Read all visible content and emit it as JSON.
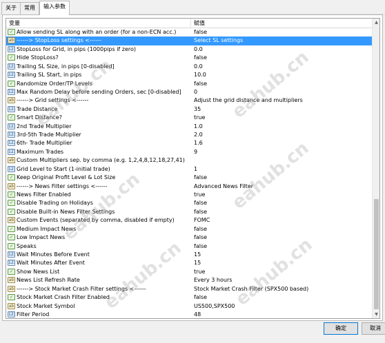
{
  "tabs": [
    "关于",
    "常用",
    "输入参数"
  ],
  "grid": {
    "header": {
      "name": "变量",
      "value": "赋值"
    },
    "rows": [
      {
        "name": "Allow sending SL along with an order (for a non-ECN acc.)",
        "value": "false",
        "icon": "bool"
      },
      {
        "name": "------> StopLoss settings <------",
        "value": "Select SL settings",
        "icon": "text",
        "selected": true
      },
      {
        "name": "StopLoss for Grid, in pips (1000pips if zero)",
        "value": "0.0",
        "icon": "num"
      },
      {
        "name": "Hide StopLoss?",
        "value": "false",
        "icon": "bool"
      },
      {
        "name": "Trailing SL Size, in pips [0-disabled]",
        "value": "0.0",
        "icon": "num"
      },
      {
        "name": "Trailing SL Start, in pips",
        "value": "10.0",
        "icon": "num"
      },
      {
        "name": "Randomize Order/TP Levels",
        "value": "false",
        "icon": "bool"
      },
      {
        "name": "Max Random Delay before sending Orders, sec [0-disabled]",
        "value": "0",
        "icon": "num"
      },
      {
        "name": "------> Grid settings <------",
        "value": "Adjust the grid distance and multipliers",
        "icon": "text"
      },
      {
        "name": "Trade Distance",
        "value": "35",
        "icon": "num"
      },
      {
        "name": "Smart Distance?",
        "value": "true",
        "icon": "bool"
      },
      {
        "name": "2nd Trade Multiplier",
        "value": "1.0",
        "icon": "num"
      },
      {
        "name": "3rd-5th Trade Multiplier",
        "value": "2.0",
        "icon": "num"
      },
      {
        "name": "6th- Trade Multiplier",
        "value": "1.6",
        "icon": "num"
      },
      {
        "name": "Maximum Trades",
        "value": "9",
        "icon": "num"
      },
      {
        "name": "Custom Multipliers sep. by comma (e.g. 1,2,4,8,12,18,27,41)",
        "value": "",
        "icon": "text"
      },
      {
        "name": "Grid Level to Start (1-initial trade)",
        "value": "1",
        "icon": "num"
      },
      {
        "name": "Keep Original Profit Level & Lot Size",
        "value": "false",
        "icon": "bool"
      },
      {
        "name": "------> News Filter settings <------",
        "value": "Advanced News Filter",
        "icon": "text"
      },
      {
        "name": "News Filter Enabled",
        "value": "true",
        "icon": "bool"
      },
      {
        "name": "Disable Trading on Holidays",
        "value": "false",
        "icon": "bool"
      },
      {
        "name": "Disable Built-in News Filter Settings",
        "value": "false",
        "icon": "bool"
      },
      {
        "name": "Custom Events (separated by comma, disabled if empty)",
        "value": "FOMC",
        "icon": "text"
      },
      {
        "name": "Medium Impact News",
        "value": "false",
        "icon": "bool"
      },
      {
        "name": "Low Impact News",
        "value": "false",
        "icon": "bool"
      },
      {
        "name": "Speaks",
        "value": "false",
        "icon": "bool"
      },
      {
        "name": "Wait Minutes Before Event",
        "value": "15",
        "icon": "num"
      },
      {
        "name": "Wait Minutes After Event",
        "value": "15",
        "icon": "num"
      },
      {
        "name": "Show News List",
        "value": "true",
        "icon": "bool"
      },
      {
        "name": "News List Refresh Rate",
        "value": "Every 3 hours",
        "icon": "text"
      },
      {
        "name": "------> Stock Market Crash Filter settings <------",
        "value": "Stock Market Crash Filter (SPX500 based)",
        "icon": "text"
      },
      {
        "name": "Stock Market Crash Filter Enabled",
        "value": "false",
        "icon": "bool"
      },
      {
        "name": "Stock Market Symbol",
        "value": "US500,SPX500",
        "icon": "text"
      },
      {
        "name": "Filter Period",
        "value": "48",
        "icon": "num"
      }
    ]
  },
  "buttons": {
    "ok": "确定",
    "cancel": "取消"
  },
  "watermarks": [
    "eahub.cn",
    "eahub.cn",
    "eahub.cn",
    "eahub.cn",
    "eahub.cn",
    "eahub.cn"
  ]
}
